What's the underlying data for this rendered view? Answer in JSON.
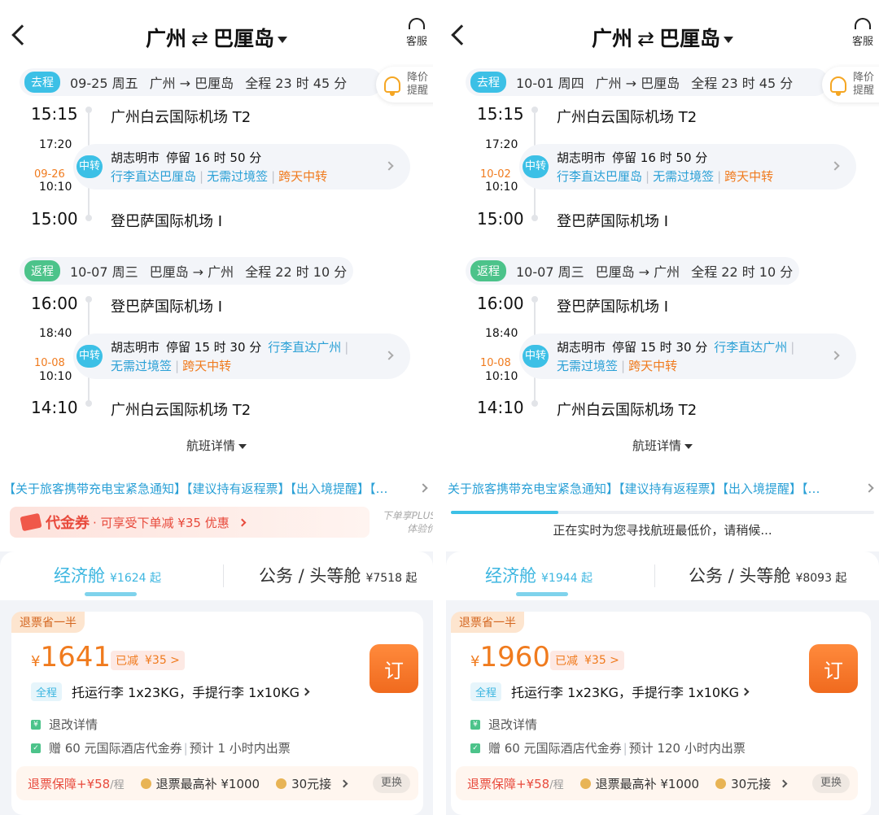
{
  "panels": [
    {
      "header": {
        "back_label": "<",
        "from": "广州",
        "swap": "⇄",
        "to": "巴厘岛",
        "service": "客服"
      },
      "outbound": {
        "tag": "去程",
        "date": "09-25 周五",
        "route": "广州 → 巴厘岛",
        "duration": "全程 23 时 45 分",
        "dep_time": "15:15",
        "dep_airport": "广州白云国际机场 T2",
        "transfer_arr": "17:20",
        "transfer_date": "09-26",
        "transfer_dep": "10:10",
        "transfer_badge": "中转",
        "transfer_city": "胡志明市",
        "transfer_stay": "停留 16 时 50 分",
        "transfer_notes": [
          "行李直达巴厘岛",
          "无需过境签",
          "跨天中转"
        ],
        "arr_time": "15:00",
        "arr_airport": "登巴萨国际机场 I"
      },
      "alert": {
        "label": "降价提醒"
      },
      "inbound": {
        "tag": "返程",
        "date": "10-07 周三",
        "route": "巴厘岛 → 广州",
        "duration": "全程 22 时 10 分",
        "dep_time": "16:00",
        "dep_airport": "登巴萨国际机场 I",
        "transfer_arr": "18:40",
        "transfer_date": "10-08",
        "transfer_dep": "10:10",
        "transfer_badge": "中转",
        "transfer_city": "胡志明市",
        "transfer_stay": "停留 15 时 30 分",
        "transfer_notes": [
          "行李直达广州",
          "无需过境签",
          "跨天中转"
        ],
        "arr_time": "14:10",
        "arr_airport": "广州白云国际机场 T2"
      },
      "details_label": "航班详情",
      "notice": "【关于旅客携带充电宝紧急通知】【建议持有返程票】【出入境提醒】【…",
      "coupon": {
        "title": "代金券",
        "desc": "· 可享受下单减 ¥35 优惠",
        "plus": "下单享PLUS体验价"
      },
      "loading_text": "",
      "cabin": {
        "econ_name": "经济舱",
        "econ_price": "¥1624 起",
        "biz_name": "公务 / 头等舱",
        "biz_price": "¥7518 起"
      },
      "fare": {
        "refund_tag": "退票省一半",
        "currency": "¥",
        "price": "1641",
        "discount_label": "已减",
        "discount_amt": "¥35 >",
        "book": "订",
        "bag_tag": "全程",
        "bag_text": "托运行李 1x23KG，手提行李 1x10KG",
        "change_info": "退改详情",
        "gift_info": "赠 60 元国际酒店代金券",
        "issue_info": "预计 1 小时内出票",
        "protect_label": "退票保障+¥58",
        "protect_unit": "/程",
        "refund_max": "退票最高补 ¥1000",
        "pickup": "30元接",
        "swap_btn": "更换"
      }
    },
    {
      "header": {
        "back_label": "<",
        "from": "广州",
        "swap": "⇄",
        "to": "巴厘岛",
        "service": "客服"
      },
      "outbound": {
        "tag": "去程",
        "date": "10-01 周四",
        "route": "广州 → 巴厘岛",
        "duration": "全程 23 时 45 分",
        "dep_time": "15:15",
        "dep_airport": "广州白云国际机场 T2",
        "transfer_arr": "17:20",
        "transfer_date": "10-02",
        "transfer_dep": "10:10",
        "transfer_badge": "中转",
        "transfer_city": "胡志明市",
        "transfer_stay": "停留 16 时 50 分",
        "transfer_notes": [
          "行李直达巴厘岛",
          "无需过境签",
          "跨天中转"
        ],
        "arr_time": "15:00",
        "arr_airport": "登巴萨国际机场 I"
      },
      "alert": {
        "label": "降价提醒"
      },
      "inbound": {
        "tag": "返程",
        "date": "10-07 周三",
        "route": "巴厘岛 → 广州",
        "duration": "全程 22 时 10 分",
        "dep_time": "16:00",
        "dep_airport": "登巴萨国际机场 I",
        "transfer_arr": "18:40",
        "transfer_date": "10-08",
        "transfer_dep": "10:10",
        "transfer_badge": "中转",
        "transfer_city": "胡志明市",
        "transfer_stay": "停留 15 时 30 分",
        "transfer_notes": [
          "行李直达广州",
          "无需过境签",
          "跨天中转"
        ],
        "arr_time": "14:10",
        "arr_airport": "广州白云国际机场 T2"
      },
      "details_label": "航班详情",
      "notice": "关于旅客携带充电宝紧急通知】【建议持有返程票】【出入境提醒】【…",
      "coupon": null,
      "loading_text": "正在实时为您寻找航班最低价，请稍候...",
      "cabin": {
        "econ_name": "经济舱",
        "econ_price": "¥1944 起",
        "biz_name": "公务 / 头等舱",
        "biz_price": "¥8093 起"
      },
      "fare": {
        "refund_tag": "退票省一半",
        "currency": "¥",
        "price": "1960",
        "discount_label": "已减",
        "discount_amt": "¥35 >",
        "book": "订",
        "bag_tag": "全程",
        "bag_text": "托运行李 1x23KG，手提行李 1x10KG",
        "change_info": "退改详情",
        "gift_info": "赠 60 元国际酒店代金券",
        "issue_info": "预计 120 小时内出票",
        "protect_label": "退票保障+¥58",
        "protect_unit": "/程",
        "refund_max": "退票最高补 ¥1000",
        "pickup": "30元接",
        "swap_btn": "更换"
      }
    }
  ],
  "colors": {
    "accent": "#3cc0e6",
    "return_tag": "#4cc38a",
    "price": "#f07b1e",
    "alert": "#f5a623",
    "coupon": "#e84a3c"
  },
  "icons": {
    "back": "chevron-left-icon",
    "service": "headset-icon",
    "alert": "bell-icon",
    "book": "book-button"
  }
}
